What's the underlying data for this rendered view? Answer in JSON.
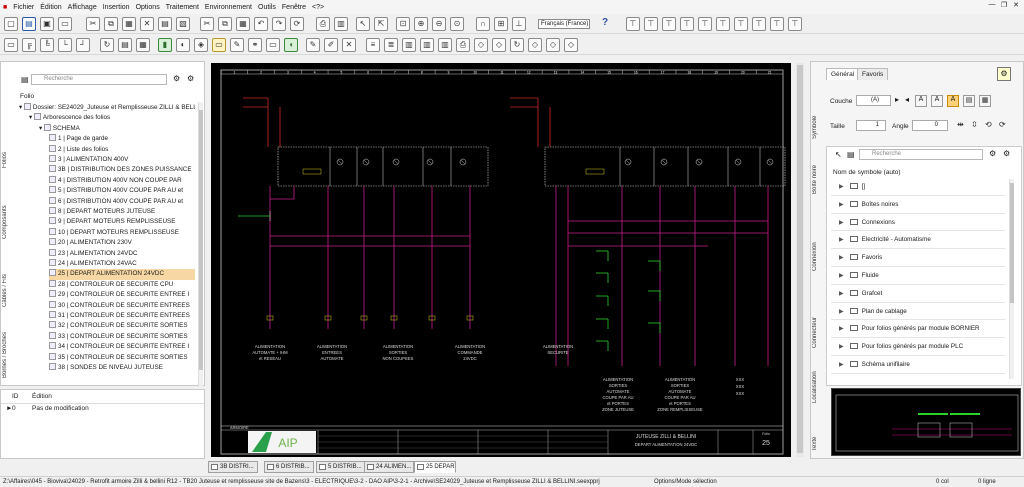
{
  "menu": [
    "Fichier",
    "Édition",
    "Affichage",
    "Insertion",
    "Options",
    "Traitement",
    "Environnement",
    "Outils",
    "Fenêtre",
    "<?>"
  ],
  "toolbar": {
    "language": "Français (France)",
    "help": "?"
  },
  "left_panel": {
    "search_placeholder": "Recherche",
    "header": "Folio",
    "vtabs": [
      "Folios",
      "Composants",
      "Câbles / Fils",
      "Bornes / Broches"
    ],
    "tree": [
      {
        "label": "Dossier: SE24029_Juteuse et Remplisseuse ZILLI & BELLINI",
        "indent": 0
      },
      {
        "label": "Arborescence des folios",
        "indent": 1
      },
      {
        "label": "SCHEMA",
        "indent": 2
      },
      {
        "label": "1 | Page de garde",
        "indent": 3
      },
      {
        "label": "2 | Liste des folios",
        "indent": 3
      },
      {
        "label": "3 | ALIMENTATION 400V",
        "indent": 3
      },
      {
        "label": "3B | DISTRIBUTION DES ZONES PUISSANCE",
        "indent": 3
      },
      {
        "label": "4 | DISTRIBUTION 400V NON COUPE PAR",
        "indent": 3
      },
      {
        "label": "5 | DISTRIBUTION 400V COUPE PAR AU et",
        "indent": 3
      },
      {
        "label": "6 | DISTRIBUTION 400V COUPE PAR AU et",
        "indent": 3
      },
      {
        "label": "8 | DEPART MOTEURS JUTEUSE",
        "indent": 3
      },
      {
        "label": "9 | DEPART MOTEURS REMPLISSEUSE",
        "indent": 3
      },
      {
        "label": "10 | DEPART MOTEURS REMPLISSEUSE",
        "indent": 3
      },
      {
        "label": "20 | ALIMENTATION 230V",
        "indent": 3
      },
      {
        "label": "23 | ALIMENTATION 24VDC",
        "indent": 3
      },
      {
        "label": "24 | ALIMENTATION 24VAC",
        "indent": 3
      },
      {
        "label": "25 | DEPART ALIMENTATION 24VDC",
        "indent": 3,
        "selected": true
      },
      {
        "label": "28 | CONTROLEUR DE SECURITE CPU",
        "indent": 3
      },
      {
        "label": "29 | CONTROLEUR DE SECURITE ENTREE I",
        "indent": 3
      },
      {
        "label": "30 | CONTROLEUR DE SECURITE ENTREES",
        "indent": 3
      },
      {
        "label": "31 | CONTROLEUR DE SECURITE ENTREES",
        "indent": 3
      },
      {
        "label": "32 | CONTROLEUR DE SECURITE SORTIES",
        "indent": 3
      },
      {
        "label": "33 | CONTROLEUR DE SECURITE SORTIES",
        "indent": 3
      },
      {
        "label": "34 | CONTROLEUR DE SECURITE ENTREE I",
        "indent": 3
      },
      {
        "label": "35 | CONTROLEUR DE SECURITE SORTIES",
        "indent": 3
      },
      {
        "label": "38 | SONDES DE NIVEAU JUTEUSE",
        "indent": 3
      }
    ]
  },
  "undo_panel": {
    "col_id": "ID",
    "col_edit": "Édition",
    "rows": [
      {
        "id": "0",
        "text": "Pas de modification"
      }
    ]
  },
  "right_panel": {
    "tabs": [
      "Général",
      "Favoris"
    ],
    "vtabs": [
      "Symbole",
      "Boîte noire",
      "Connexion",
      "Connecteur",
      "Localisation",
      "Texte"
    ],
    "couche_label": "Couche",
    "couche_value": "(A)",
    "taille_label": "Taille",
    "taille_value": "1",
    "angle_label": "Angle",
    "angle_value": "0",
    "search_placeholder": "Recherche",
    "list_header": "Nom de symbole (auto)",
    "items": [
      "[]",
      "Boîtes noires",
      "Connexions",
      "Electricité - Automatisme",
      "Favoris",
      "Fluide",
      "Grafcet",
      "Plan de cablage",
      "Pour folios générés par module BORNIER",
      "Pour folios générés par module PLC",
      "Schéma unifilaire"
    ]
  },
  "drawing": {
    "columns": [
      "1",
      "2",
      "3",
      "4",
      "5",
      "6",
      "7",
      "8",
      "9",
      "10",
      "11",
      "12",
      "13",
      "14",
      "15",
      "16",
      "17",
      "18",
      "19",
      "20",
      "21"
    ],
    "labels": {
      "feed1_a": "ALIMENTATION",
      "feed1_b": "AUTOMATE + IHM",
      "feed1_c": "et RESEAU",
      "feed2_a": "ALIMENTATION",
      "feed2_b": "ENTREES",
      "feed2_c": "AUTOMATE",
      "feed3_a": "ALIMENTATION",
      "feed3_b": "SORTIES",
      "feed3_c": "NON COUPEES",
      "feed4_a": "ALIMENTATION",
      "feed4_b": "COMMANDE",
      "feed4_c": "24VDC",
      "feed5_a": "ALIMENTATION",
      "feed5_b": "SECURITE",
      "feed6_a": "ALIMENTATION",
      "feed6_b": "SORTIES",
      "feed6_c": "AUTOMATE",
      "feed6_d": "COUPE PAR AU",
      "feed6_e": "et PORTES",
      "feed6_f": "ZONE JUTEUSE",
      "feed7_a": "ALIMENTATION",
      "feed7_b": "SORTIES",
      "feed7_c": "AUTOMATE",
      "feed7_d": "COUPE PAR AU",
      "feed7_e": "et PORTES",
      "feed7_f": "ZONE REMPLISSEUSE",
      "xxx": "XXX",
      "armoire": "ARMOIRE",
      "title_1": "JUTEUSE ZILLI & BELLINI",
      "title_2": "DEPART ALIMENTATION 24VDC",
      "folio_label": "Folio",
      "folio_no": "25",
      "logo": "AIP"
    }
  },
  "page_tabs": [
    {
      "label": "3B DISTRI...",
      "active": false
    },
    {
      "label": "6 DISTRIB...",
      "active": false
    },
    {
      "label": "5 DISTRIB...",
      "active": false
    },
    {
      "label": "24 ALIMEN...",
      "active": false
    },
    {
      "label": "25 DEPART ...",
      "active": true
    }
  ],
  "status": {
    "path": "Z:\\Affaires\\045 - Bioviva\\24029 - Retrofit armoire Zilli & bellini R12 - TB20 Juteuse et remplisseuse site de Bazens\\3 - ELECTRIQUE\\3-2 - DAO AIP\\3-2-1 - Archive\\SE24029_Juteuse et Remplisseuse ZILLI & BELLINI.seexpprj",
    "mode": "Options/Mode sélection",
    "col": "0 col",
    "line": "0 ligne"
  }
}
